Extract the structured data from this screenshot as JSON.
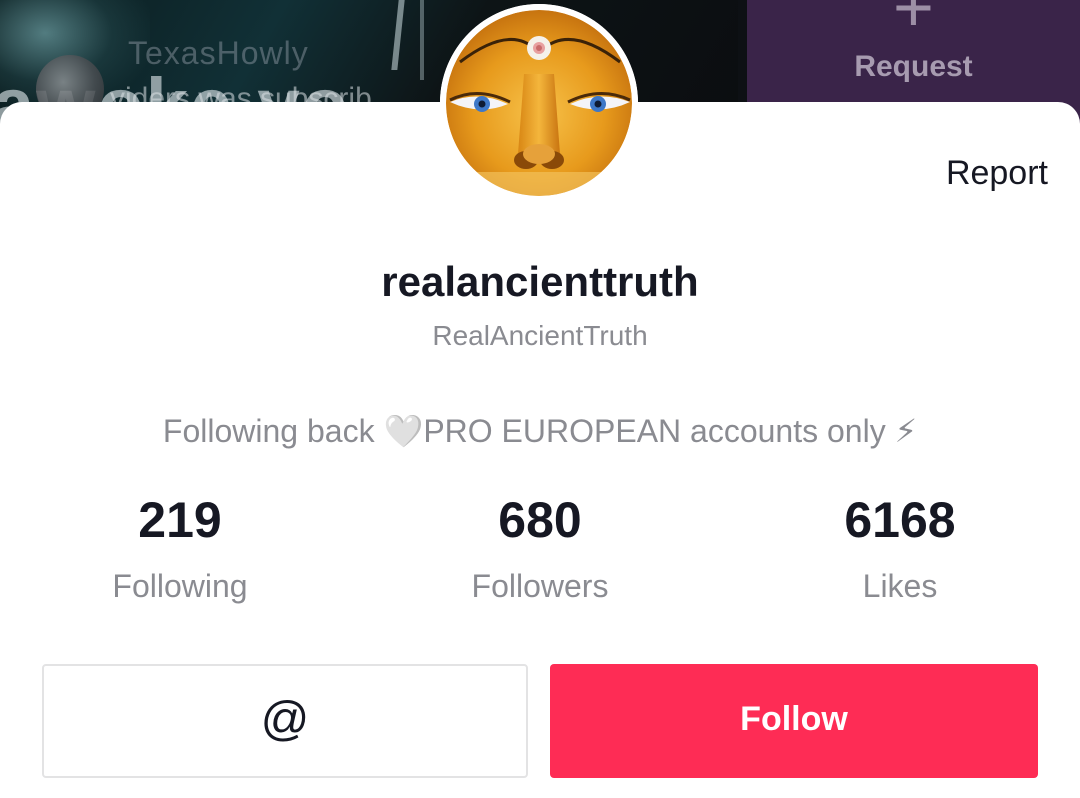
{
  "background": {
    "commenter_name": "TexasHowly",
    "comment_text": "viders was subscrib",
    "caption_text": "awoke vo"
  },
  "request": {
    "plus_glyph": "+",
    "label": "Request"
  },
  "profile": {
    "report_label": "Report",
    "username": "realancienttruth",
    "display_name": "RealAncientTruth",
    "bio": "Following back 🤍PRO EUROPEAN accounts only ⚡",
    "avatar_icon": "golden-buddha-face-icon"
  },
  "stats": [
    {
      "value": "219",
      "label": "Following"
    },
    {
      "value": "680",
      "label": "Followers"
    },
    {
      "value": "6168",
      "label": "Likes"
    }
  ],
  "actions": {
    "mention_glyph": "@",
    "follow_label": "Follow"
  },
  "colors": {
    "accent": "#fe2c55",
    "text_primary": "#161823",
    "text_secondary": "#8a8b91",
    "request_panel": "#3a2449"
  }
}
